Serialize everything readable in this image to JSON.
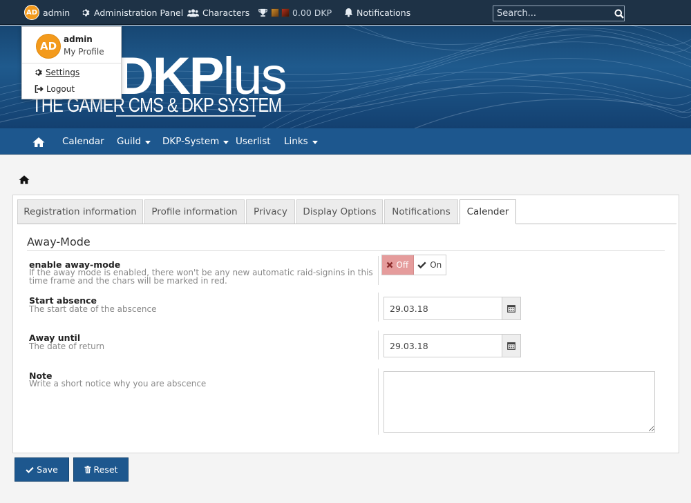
{
  "topbar": {
    "user": {
      "initials": "AD",
      "name": "admin"
    },
    "admin_panel": "Administration Panel",
    "characters": "Characters",
    "dkp": "0.00 DKP",
    "notifications": "Notifications",
    "search_placeholder": "Search..."
  },
  "user_menu": {
    "initials": "AD",
    "name": "admin",
    "my_profile": "My Profile",
    "settings": "Settings",
    "logout": "Logout"
  },
  "banner": {
    "logo_bold": "DKP",
    "logo_light": "lus",
    "tagline": "THE GAMER CMS & DKP SYSTEM"
  },
  "nav": {
    "calendar": "Calendar",
    "guild": "Guild",
    "dkp_system": "DKP-System",
    "userlist": "Userlist",
    "links": "Links"
  },
  "tabs": [
    {
      "label": "Registration information"
    },
    {
      "label": "Profile information"
    },
    {
      "label": "Privacy"
    },
    {
      "label": "Display Options"
    },
    {
      "label": "Notifications"
    },
    {
      "label": "Calender",
      "active": true
    }
  ],
  "form": {
    "section_title": "Away-Mode",
    "away_mode": {
      "label": "enable away-mode",
      "help_line1": "If the away mode is enabled, there won't be any new automatic raid-signins in this",
      "help_line2": "time frame and the chars will be marked in red.",
      "off": "Off",
      "on": "On",
      "value": "Off"
    },
    "start": {
      "label": "Start absence",
      "help": "The start date of the abscence",
      "value": "29.03.18"
    },
    "until": {
      "label": "Away until",
      "help": "The date of return",
      "value": "29.03.18"
    },
    "note": {
      "label": "Note",
      "help": "Write a short notice why you are abscence",
      "value": ""
    }
  },
  "buttons": {
    "save": "Save",
    "reset": "Reset"
  },
  "colors": {
    "topbar": "#1e3246",
    "nav": "#1d578e",
    "accent_orange": "#f39a1c",
    "toggle_off": "#e59c9c"
  }
}
